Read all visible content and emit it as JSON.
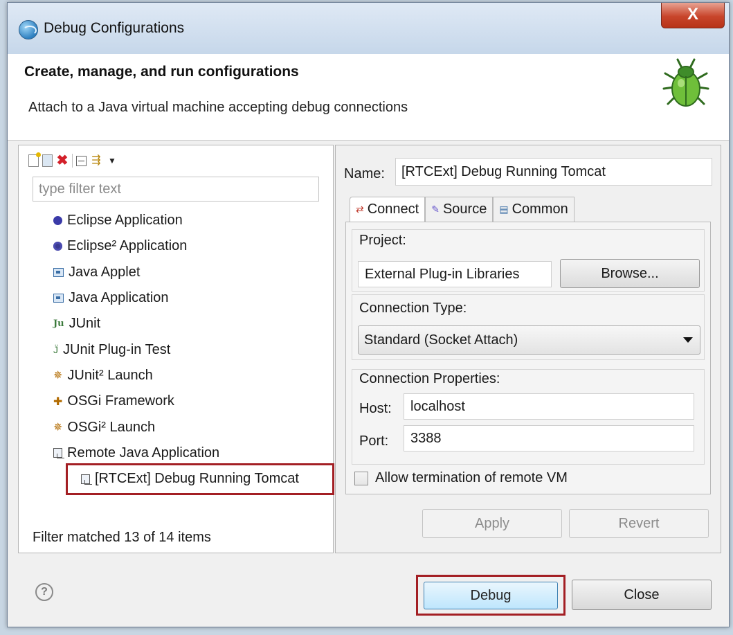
{
  "window": {
    "title": "Debug Configurations",
    "close_glyph": "X"
  },
  "header": {
    "title": "Create, manage, and run configurations",
    "description": "Attach to a Java virtual machine accepting debug connections"
  },
  "left": {
    "filter_placeholder": "type filter text",
    "items": [
      {
        "label": "Eclipse Application",
        "icon": "eclipse-icon"
      },
      {
        "label": "Eclipse² Application",
        "icon": "eclipse2-icon"
      },
      {
        "label": "Java Applet",
        "icon": "java-applet-icon"
      },
      {
        "label": "Java Application",
        "icon": "java-application-icon"
      },
      {
        "label": "JUnit",
        "icon": "junit-icon"
      },
      {
        "label": "JUnit Plug-in Test",
        "icon": "junit-plugin-icon"
      },
      {
        "label": "JUnit² Launch",
        "icon": "junit2-launch-icon"
      },
      {
        "label": "OSGi Framework",
        "icon": "osgi-icon"
      },
      {
        "label": "OSGi² Launch",
        "icon": "osgi2-launch-icon"
      },
      {
        "label": "Remote Java Application",
        "icon": "remote-java-icon"
      },
      {
        "label": "[RTCExt] Debug Running Tomcat",
        "icon": "remote-java-icon"
      }
    ],
    "filter_status": "Filter matched 13 of 14 items"
  },
  "right": {
    "name_label": "Name:",
    "name_value": "[RTCExt] Debug Running Tomcat",
    "tabs": [
      {
        "label": "Connect",
        "icon": "connect-icon"
      },
      {
        "label": "Source",
        "icon": "source-icon"
      },
      {
        "label": "Common",
        "icon": "common-icon"
      }
    ],
    "project_label": "Project:",
    "project_value": "External Plug-in Libraries",
    "browse_label": "Browse...",
    "connection_type_label": "Connection Type:",
    "connection_type_value": "Standard (Socket Attach)",
    "connection_props_label": "Connection Properties:",
    "host_label": "Host:",
    "host_value": "localhost",
    "port_label": "Port:",
    "port_value": "3388",
    "allow_termination_label": "Allow termination of remote VM",
    "allow_termination_checked": false,
    "apply_label": "Apply",
    "revert_label": "Revert"
  },
  "footer": {
    "help_glyph": "?",
    "debug_label": "Debug",
    "close_label": "Close"
  },
  "colors": {
    "highlight_border": "#a31f24",
    "title_close": "#c8452b"
  }
}
